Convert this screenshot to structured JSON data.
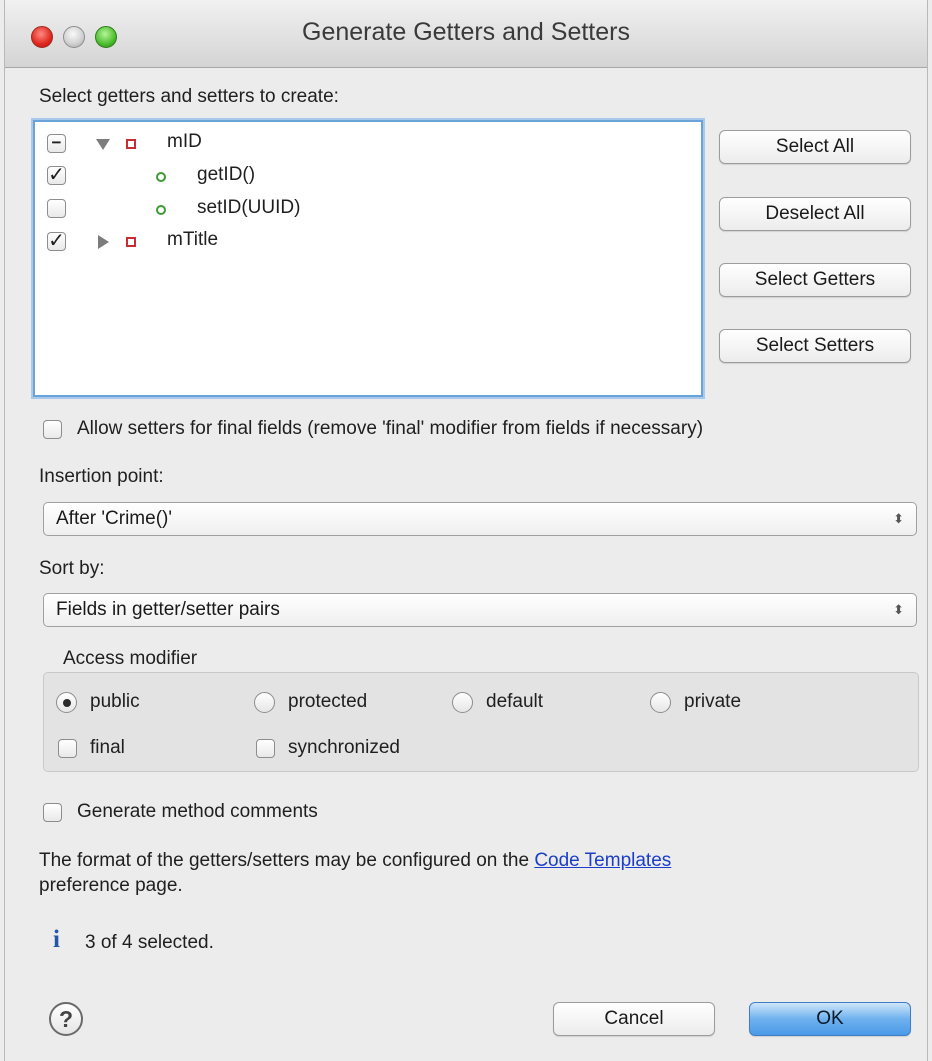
{
  "window": {
    "title": "Generate Getters and Setters"
  },
  "tree_section": {
    "label": "Select getters and setters to create:",
    "items": [
      {
        "label": "mID",
        "check": "mixed",
        "check_glyph": "−",
        "expander": "expanded",
        "icon": "field-icon"
      },
      {
        "label": "getID()",
        "check": "checked",
        "check_glyph": "✓",
        "icon": "method-icon"
      },
      {
        "label": "setID(UUID)",
        "check": "unchecked",
        "check_glyph": "",
        "icon": "method-icon"
      },
      {
        "label": "mTitle",
        "check": "checked",
        "check_glyph": "✓",
        "expander": "collapsed",
        "icon": "field-icon"
      }
    ]
  },
  "side_buttons": {
    "select_all": "Select All",
    "deselect_all": "Deselect All",
    "select_getters": "Select Getters",
    "select_setters": "Select Setters"
  },
  "allow_final": {
    "label": "Allow setters for final fields (remove 'final' modifier from fields if necessary)",
    "checked": false
  },
  "insertion_point": {
    "label": "Insertion point:",
    "value": "After 'Crime()'"
  },
  "sort_by": {
    "label": "Sort by:",
    "value": "Fields in getter/setter pairs"
  },
  "access_modifier": {
    "label": "Access modifier",
    "options": [
      {
        "label": "public",
        "selected": true
      },
      {
        "label": "protected",
        "selected": false
      },
      {
        "label": "default",
        "selected": false
      },
      {
        "label": "private",
        "selected": false
      }
    ],
    "final_label": "final",
    "synchronized_label": "synchronized"
  },
  "comments": {
    "label": "Generate method comments",
    "checked": false
  },
  "info": {
    "text_before": "The format of the getters/setters may be configured on the ",
    "link": "Code Templates",
    "text_after": "preference page.",
    "status_icon": "i",
    "status": "3 of 4 selected."
  },
  "footer": {
    "help_glyph": "?",
    "cancel": "Cancel",
    "ok": "OK"
  },
  "colors": {
    "focus_border": "#6aa3d8",
    "default_button": "#4b9ae8",
    "link": "#1a3ec7",
    "field_icon": "#cc2b34",
    "method_icon": "#3e9a33"
  }
}
